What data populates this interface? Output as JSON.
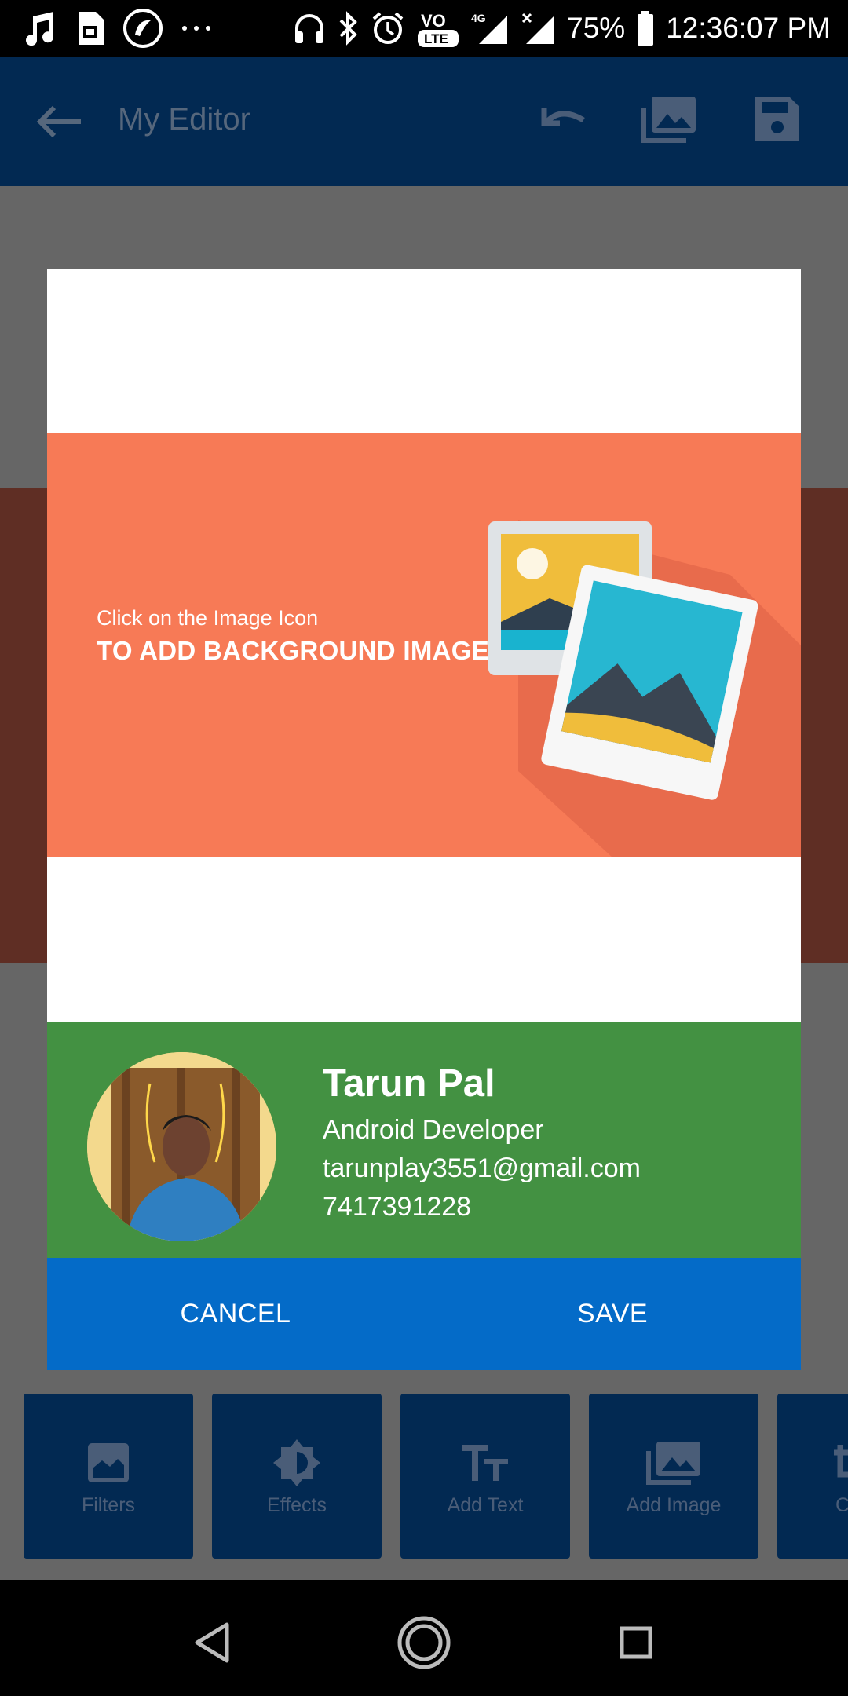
{
  "status_bar": {
    "battery": "75%",
    "time": "12:36:07 PM",
    "network": "4G",
    "volte": "VO LTE"
  },
  "app_bar": {
    "title": "My Editor"
  },
  "dialog": {
    "banner": {
      "line1": "Click on the Image Icon",
      "line2": "TO ADD BACKGROUND IMAGE"
    },
    "card": {
      "name": "Tarun Pal",
      "role": "Android Developer",
      "email": "tarunplay3551@gmail.com",
      "phone": "7417391228"
    },
    "actions": {
      "cancel": "CANCEL",
      "save": "SAVE"
    }
  },
  "toolbar": {
    "items": [
      {
        "label": "Filters",
        "icon": "filters-icon"
      },
      {
        "label": "Effects",
        "icon": "effects-icon"
      },
      {
        "label": "Add Text",
        "icon": "add-text-icon"
      },
      {
        "label": "Add Image",
        "icon": "add-image-icon"
      },
      {
        "label": "C",
        "icon": "crop-icon"
      }
    ]
  },
  "colors": {
    "app_bar": "#022952",
    "banner": "#f77a56",
    "card": "#439142",
    "dialog_actions": "#046bc8"
  }
}
